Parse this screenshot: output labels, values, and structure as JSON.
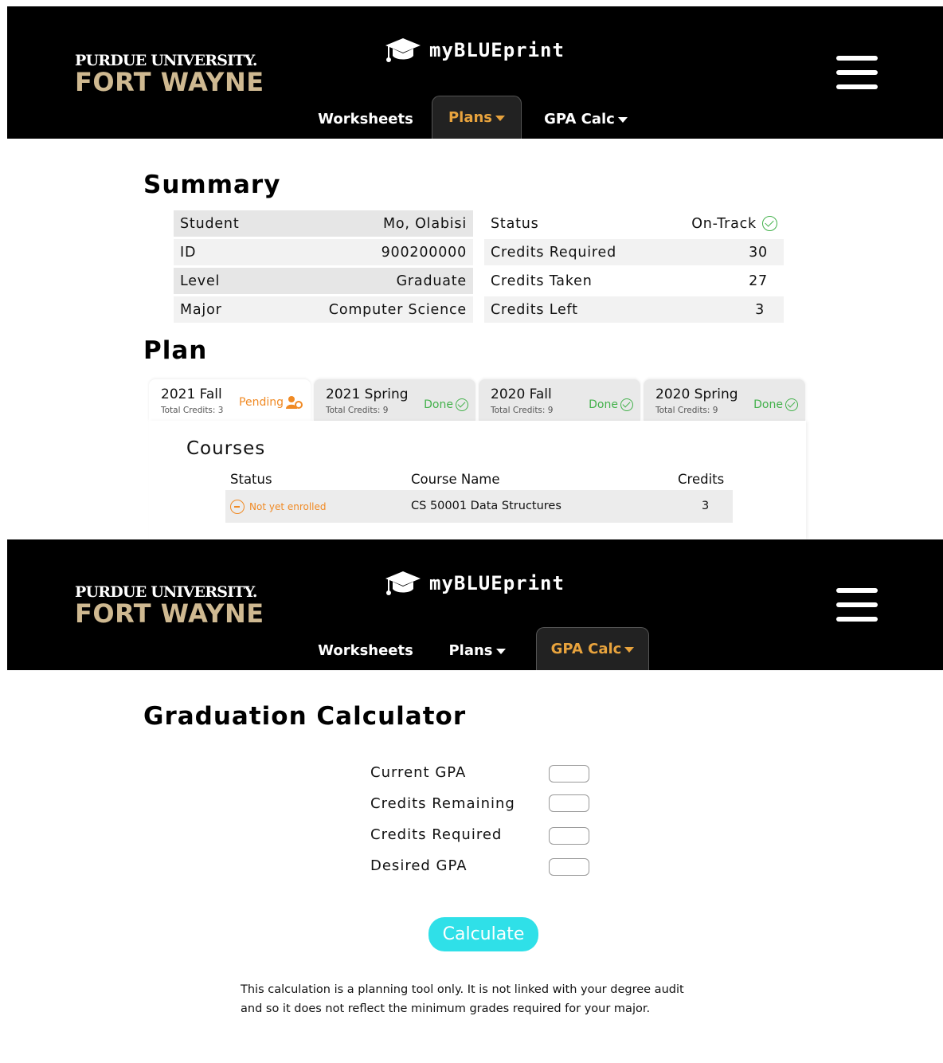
{
  "header": {
    "logo_line1": "PURDUE UNIVERSITY.",
    "logo_line2": "FORT WAYNE",
    "brand": "myBLUEprint",
    "nav": {
      "worksheets": "Worksheets",
      "plans": "Plans",
      "gpa_calc": "GPA Calc"
    }
  },
  "summary": {
    "title": "Summary",
    "left": [
      {
        "label": "Student",
        "value": "Mo, Olabisi"
      },
      {
        "label": "ID",
        "value": "900200000"
      },
      {
        "label": "Level",
        "value": "Graduate"
      },
      {
        "label": "Major",
        "value": "Computer Science"
      }
    ],
    "right": [
      {
        "label": "Status",
        "value": "On-Track"
      },
      {
        "label": "Credits Required",
        "value": "30"
      },
      {
        "label": "Credits Taken",
        "value": "27"
      },
      {
        "label": "Credits Left",
        "value": "3"
      }
    ]
  },
  "plan": {
    "title": "Plan",
    "tabs": [
      {
        "term": "2021 Fall",
        "credits": "Total Credits: 3",
        "status": "Pending"
      },
      {
        "term": "2021 Spring",
        "credits": "Total Credits: 9",
        "status": "Done"
      },
      {
        "term": "2020 Fall",
        "credits": "Total Credits: 9",
        "status": "Done"
      },
      {
        "term": "2020 Spring",
        "credits": "Total Credits: 9",
        "status": "Done"
      }
    ],
    "courses": {
      "title": "Courses",
      "headers": {
        "status": "Status",
        "name": "Course Name",
        "credits": "Credits"
      },
      "rows": [
        {
          "status": "Not yet enrolled",
          "name": "CS 50001  Data Structures",
          "credits": "3"
        }
      ]
    }
  },
  "calculator": {
    "title": "Graduation Calculator",
    "fields": [
      {
        "label": "Current GPA",
        "value": ""
      },
      {
        "label": "Credits Remaining",
        "value": ""
      },
      {
        "label": "Credits Required",
        "value": ""
      },
      {
        "label": "Desired GPA",
        "value": ""
      }
    ],
    "button": "Calculate",
    "disclaimer_line1": "This calculation is a planning tool only. It is not linked with your degree audit",
    "disclaimer_line2": "and so it does not reflect the minimum grades required for your major."
  },
  "colors": {
    "header_bg": "#000000",
    "accent_orange": "#e8a33d",
    "gold": "#cfb991",
    "success": "#43b14b",
    "pending": "#f08a24",
    "button": "#2fe0e8"
  },
  "icons": [
    "graduation-cap-icon",
    "hamburger-menu-icon",
    "caret-down-icon",
    "check-circle-icon",
    "person-clock-icon",
    "minus-circle-icon"
  ]
}
